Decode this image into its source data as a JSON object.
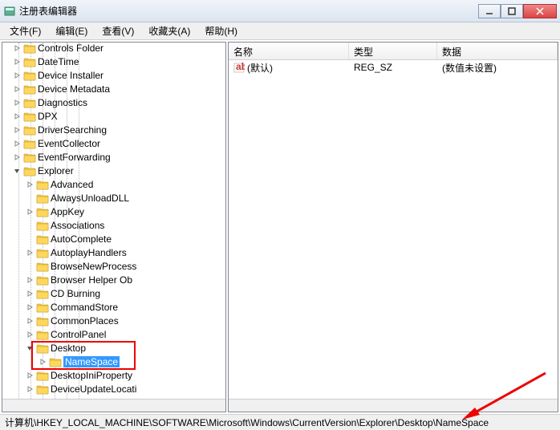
{
  "window": {
    "title": "注册表编辑器"
  },
  "menu": {
    "file": "文件(F)",
    "edit": "编辑(E)",
    "view": "查看(V)",
    "favorites": "收藏夹(A)",
    "help": "帮助(H)"
  },
  "tree": {
    "items": [
      {
        "label": "Controls Folder",
        "depth": 7,
        "expand": "closed"
      },
      {
        "label": "DateTime",
        "depth": 7,
        "expand": "closed"
      },
      {
        "label": "Device Installer",
        "depth": 7,
        "expand": "closed"
      },
      {
        "label": "Device Metadata",
        "depth": 7,
        "expand": "closed"
      },
      {
        "label": "Diagnostics",
        "depth": 7,
        "expand": "closed"
      },
      {
        "label": "DPX",
        "depth": 7,
        "expand": "closed"
      },
      {
        "label": "DriverSearching",
        "depth": 7,
        "expand": "closed"
      },
      {
        "label": "EventCollector",
        "depth": 7,
        "expand": "closed"
      },
      {
        "label": "EventForwarding",
        "depth": 7,
        "expand": "closed"
      },
      {
        "label": "Explorer",
        "depth": 7,
        "expand": "open"
      },
      {
        "label": "Advanced",
        "depth": 8,
        "expand": "closed"
      },
      {
        "label": "AlwaysUnloadDLL",
        "depth": 8,
        "expand": "none"
      },
      {
        "label": "AppKey",
        "depth": 8,
        "expand": "closed"
      },
      {
        "label": "Associations",
        "depth": 8,
        "expand": "none"
      },
      {
        "label": "AutoComplete",
        "depth": 8,
        "expand": "none"
      },
      {
        "label": "AutoplayHandlers",
        "depth": 8,
        "expand": "closed"
      },
      {
        "label": "BrowseNewProcess",
        "depth": 8,
        "expand": "none"
      },
      {
        "label": "Browser Helper Ob",
        "depth": 8,
        "expand": "closed"
      },
      {
        "label": "CD Burning",
        "depth": 8,
        "expand": "closed"
      },
      {
        "label": "CommandStore",
        "depth": 8,
        "expand": "closed"
      },
      {
        "label": "CommonPlaces",
        "depth": 8,
        "expand": "closed"
      },
      {
        "label": "ControlPanel",
        "depth": 8,
        "expand": "closed"
      },
      {
        "label": "Desktop",
        "depth": 8,
        "expand": "open",
        "hl_start": true
      },
      {
        "label": "NameSpace",
        "depth": 9,
        "expand": "closed",
        "selected": true,
        "hl_end": true
      },
      {
        "label": "DesktopIniProperty",
        "depth": 8,
        "expand": "closed"
      },
      {
        "label": "DeviceUpdateLocati",
        "depth": 8,
        "expand": "closed"
      }
    ]
  },
  "list": {
    "columns": {
      "name": "名称",
      "type": "类型",
      "data": "数据"
    },
    "rows": [
      {
        "name": "(默认)",
        "type": "REG_SZ",
        "data": "(数值未设置)"
      }
    ]
  },
  "status": {
    "path": "计算机\\HKEY_LOCAL_MACHINE\\SOFTWARE\\Microsoft\\Windows\\CurrentVersion\\Explorer\\Desktop\\NameSpace"
  }
}
